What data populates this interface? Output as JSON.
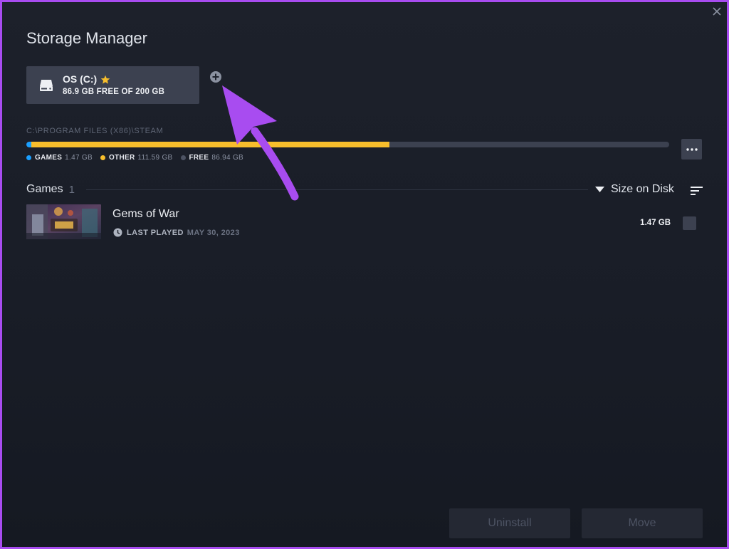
{
  "window": {
    "title": "Storage Manager"
  },
  "drive": {
    "name": "OS (C:)",
    "free_text": "86.9 GB FREE OF 200 GB",
    "icon": "hard-drive-icon",
    "favorite_icon": "star-icon"
  },
  "storage": {
    "path": "C:\\PROGRAM FILES (X86)\\STEAM",
    "total_gb": 200,
    "segments": [
      {
        "key": "GAMES",
        "value": "1.47 GB",
        "gb": 1.47,
        "color": "#1a9fff"
      },
      {
        "key": "OTHER",
        "value": "111.59 GB",
        "gb": 111.59,
        "color": "#f7be2c"
      },
      {
        "key": "FREE",
        "value": "86.94 GB",
        "gb": 86.94,
        "color": "#3c4150"
      }
    ]
  },
  "games_section": {
    "label": "Games",
    "count": "1",
    "sort_label": "Size on Disk"
  },
  "games": [
    {
      "title": "Gems of War",
      "last_played_label": "LAST PLAYED",
      "last_played_date": "MAY 30, 2023",
      "size": "1.47 GB"
    }
  ],
  "actions": {
    "uninstall_label": "Uninstall",
    "move_label": "Move"
  },
  "colors": {
    "accent_blue": "#1a9fff",
    "accent_yellow": "#f7be2c",
    "annotation_purple": "#a84cf0"
  }
}
